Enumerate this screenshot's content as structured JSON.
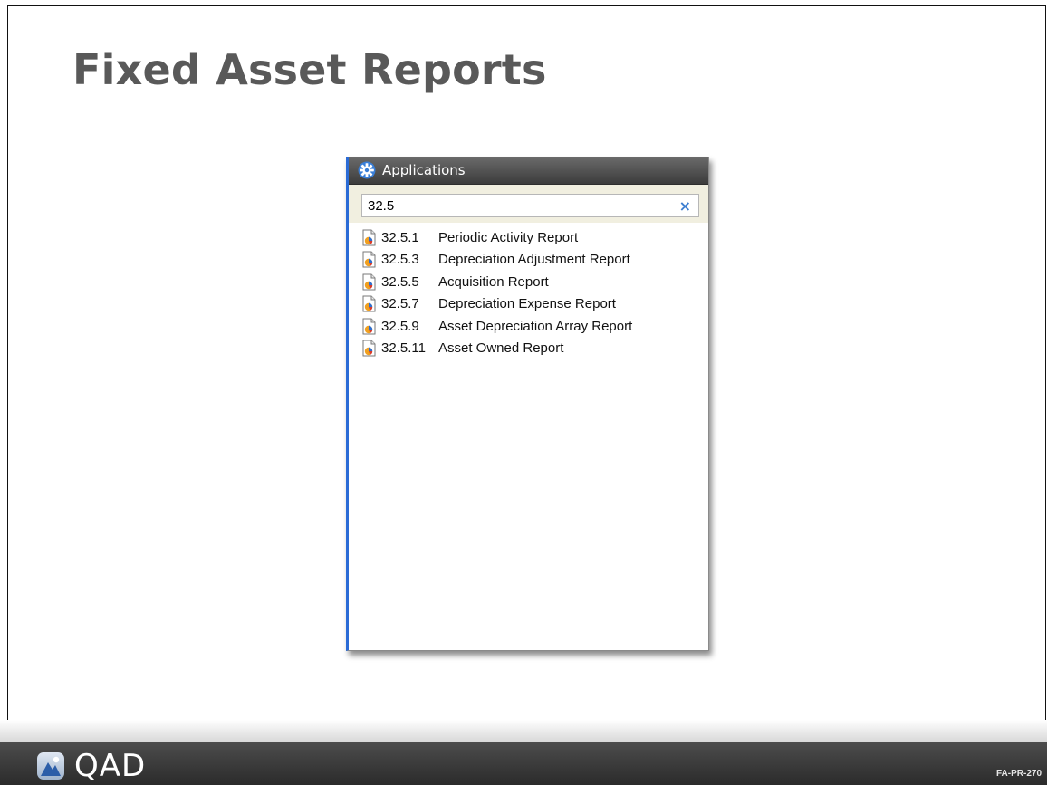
{
  "slide": {
    "title": "Fixed Asset Reports",
    "code": "FA-PR-270"
  },
  "panel": {
    "title": "Applications",
    "header_icon": "gear-icon",
    "search": {
      "value": "32.5",
      "clear_icon": "close-icon",
      "clear_glyph": "×"
    },
    "items": [
      {
        "code": "32.5.1",
        "label": "Periodic Activity Report",
        "icon": "report-document-icon"
      },
      {
        "code": "32.5.3",
        "label": "Depreciation Adjustment Report",
        "icon": "report-document-icon"
      },
      {
        "code": "32.5.5",
        "label": "Acquisition Report",
        "icon": "report-document-icon"
      },
      {
        "code": "32.5.7",
        "label": "Depreciation Expense Report",
        "icon": "report-document-icon"
      },
      {
        "code": "32.5.9",
        "label": "Asset Depreciation Array Report",
        "icon": "report-document-icon"
      },
      {
        "code": "32.5.11",
        "label": "Asset Owned Report",
        "icon": "report-document-icon"
      }
    ]
  },
  "footer": {
    "logo_text": "QAD"
  },
  "colors": {
    "title_gray": "#595959",
    "panel_accent": "#2a6bd6",
    "header_dark": "#3c3c3c",
    "search_bg": "#f1efe0",
    "clear_blue": "#3d7ed0",
    "footer_bg": "#333333"
  }
}
